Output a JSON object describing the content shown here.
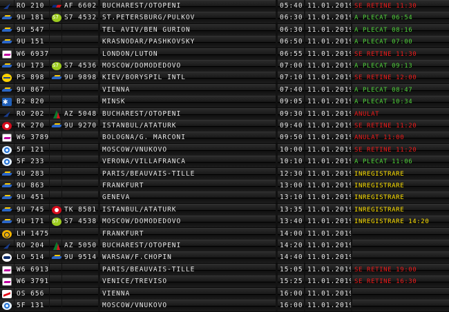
{
  "colors": {
    "text": "#e8e8e8",
    "status_red": "#f01a1a",
    "status_green": "#4fd13a",
    "status_yellow": "#ffe100",
    "board_bg": "#0a0a0a"
  },
  "flights": [
    {
      "logo1": "tarom-icon",
      "flight1": "RO 210",
      "logo2": "air-france-icon",
      "flight2": "AF 6602",
      "destination": "BUCHAREST/OTOPENI",
      "time": "05:40",
      "date": "11.01.2019",
      "status": "SE RETINE 11:30",
      "status_color": "red"
    },
    {
      "logo1": "wing-icon",
      "flight1": "9U 181",
      "logo2": "s7-icon",
      "flight2": "S7 4532",
      "destination": "ST.PETERSBURG/PULKOV",
      "time": "06:30",
      "date": "11.01.2019",
      "status": "A PLECAT 06:54",
      "status_color": "green"
    },
    {
      "logo1": "wing-icon",
      "flight1": "9U 547",
      "logo2": "",
      "flight2": "",
      "destination": "TEL AVIV/BEN GURION",
      "time": "06:30",
      "date": "11.01.2019",
      "status": "A PLECAT 08:16",
      "status_color": "green"
    },
    {
      "logo1": "wing-icon",
      "flight1": "9U 151",
      "logo2": "",
      "flight2": "",
      "destination": "KRASNODAR/PASHKOVSKY",
      "time": "06:50",
      "date": "11.01.2019",
      "status": "A PLECAT 07:00",
      "status_color": "green"
    },
    {
      "logo1": "wizz-icon",
      "flight1": "W6 6937",
      "logo2": "",
      "flight2": "",
      "destination": "LONDON/LUTON",
      "time": "06:55",
      "date": "11.01.2019",
      "status": "SE RETINE 11:30",
      "status_color": "red"
    },
    {
      "logo1": "wing-icon",
      "flight1": "9U 173",
      "logo2": "s7-icon",
      "flight2": "S7 4536",
      "destination": "MOSCOW/DOMODEDOVO",
      "time": "07:00",
      "date": "11.01.2019",
      "status": "A PLECAT 09:13",
      "status_color": "green"
    },
    {
      "logo1": "ps-icon",
      "flight1": "PS 898",
      "logo2": "wing-icon",
      "flight2": "9U 9898",
      "destination": "KIEV/BORYSPIL INTL",
      "time": "07:10",
      "date": "11.01.2019",
      "status": "SE RETINE 12:00",
      "status_color": "red"
    },
    {
      "logo1": "wing-icon",
      "flight1": "9U 867",
      "logo2": "",
      "flight2": "",
      "destination": "VIENNA",
      "time": "07:40",
      "date": "11.01.2019",
      "status": "A PLECAT 08:47",
      "status_color": "green"
    },
    {
      "logo1": "snowflake-icon",
      "flight1": "B2 820",
      "logo2": "",
      "flight2": "",
      "destination": "MINSK",
      "time": "09:05",
      "date": "11.01.2019",
      "status": "A PLECAT 10:34",
      "status_color": "green"
    },
    {
      "logo1": "tarom-icon",
      "flight1": "RO 202",
      "logo2": "alitalia-icon",
      "flight2": "AZ 5048",
      "destination": "BUCHAREST/OTOPENI",
      "time": "09:30",
      "date": "11.01.2019",
      "status": "ANULAT",
      "status_color": "red"
    },
    {
      "logo1": "turkish-icon",
      "flight1": "TK 270",
      "logo2": "wing-icon",
      "flight2": "9U 9270",
      "destination": "ISTANBUL/ATATURK",
      "time": "09:40",
      "date": "11.01.2019",
      "status": "SE RETINE 11:20",
      "status_color": "red"
    },
    {
      "logo1": "wizz-icon",
      "flight1": "W6 3789",
      "logo2": "",
      "flight2": "",
      "destination": "BOLOGNA/G. MARCONI",
      "time": "09:50",
      "date": "11.01.2019",
      "status": "ANULAT 11:00",
      "status_color": "red"
    },
    {
      "logo1": "flyone-icon",
      "flight1": "5F 121",
      "logo2": "",
      "flight2": "",
      "destination": "MOSCOW/VNUKOVO",
      "time": "10:00",
      "date": "11.01.2019",
      "status": "SE RETINE 11:20",
      "status_color": "red"
    },
    {
      "logo1": "flyone-icon",
      "flight1": "5F 233",
      "logo2": "",
      "flight2": "",
      "destination": "VERONA/VILLAFRANCA",
      "time": "10:10",
      "date": "11.01.2019",
      "status": "A PLECAT 11:06",
      "status_color": "green"
    },
    {
      "logo1": "wing-icon",
      "flight1": "9U 283",
      "logo2": "",
      "flight2": "",
      "destination": "PARIS/BEAUVAIS-TILLE",
      "time": "12:30",
      "date": "11.01.2019",
      "status": "INREGISTRARE",
      "status_color": "yellow"
    },
    {
      "logo1": "wing-icon",
      "flight1": "9U 863",
      "logo2": "",
      "flight2": "",
      "destination": "FRANKFURT",
      "time": "13:00",
      "date": "11.01.2019",
      "status": "INREGISTRARE",
      "status_color": "yellow"
    },
    {
      "logo1": "wing-icon",
      "flight1": "9U 451",
      "logo2": "",
      "flight2": "",
      "destination": "GENEVA",
      "time": "13:10",
      "date": "11.01.2019",
      "status": "INREGISTRARE",
      "status_color": "yellow"
    },
    {
      "logo1": "wing-icon",
      "flight1": "9U 745",
      "logo2": "turkish-icon",
      "flight2": "TK 8581",
      "destination": "ISTANBUL/ATATURK",
      "time": "13:35",
      "date": "11.01.2019",
      "status": "INREGISTRARE",
      "status_color": "yellow"
    },
    {
      "logo1": "wing-icon",
      "flight1": "9U 171",
      "logo2": "s7-icon",
      "flight2": "S7 4538",
      "destination": "MOSCOW/DOMODEDOVO",
      "time": "13:40",
      "date": "11.01.2019",
      "status": "INREGISTRARE 14:20",
      "status_color": "yellow"
    },
    {
      "logo1": "lufthansa-icon",
      "flight1": "LH 1475",
      "logo2": "",
      "flight2": "",
      "destination": "FRANKFURT",
      "time": "14:00",
      "date": "11.01.2019",
      "status": "",
      "status_color": "none"
    },
    {
      "logo1": "tarom-icon",
      "flight1": "RO 204",
      "logo2": "alitalia-icon",
      "flight2": "AZ 5050",
      "destination": "BUCHAREST/OTOPENI",
      "time": "14:20",
      "date": "11.01.2019",
      "status": "",
      "status_color": "none"
    },
    {
      "logo1": "lot-icon",
      "flight1": "LO 514",
      "logo2": "wing-icon",
      "flight2": "9U 9514",
      "destination": "WARSAW/F.CHOPIN",
      "time": "14:40",
      "date": "11.01.2019",
      "status": "",
      "status_color": "none"
    },
    {
      "logo1": "wizz-icon",
      "flight1": "W6 6913",
      "logo2": "",
      "flight2": "",
      "destination": "PARIS/BEAUVAIS-TILLE",
      "time": "15:05",
      "date": "11.01.2019",
      "status": "SE RETINE 19:00",
      "status_color": "red"
    },
    {
      "logo1": "wizz-icon",
      "flight1": "W6 3791",
      "logo2": "",
      "flight2": "",
      "destination": "VENICE/TREVISO",
      "time": "15:25",
      "date": "11.01.2019",
      "status": "SE RETINE 16:30",
      "status_color": "red"
    },
    {
      "logo1": "austrian-icon",
      "flight1": "OS 656",
      "logo2": "",
      "flight2": "",
      "destination": "VIENNA",
      "time": "16:00",
      "date": "11.01.2019",
      "status": "",
      "status_color": "none"
    },
    {
      "logo1": "flyone-icon",
      "flight1": "5F 131",
      "logo2": "",
      "flight2": "",
      "destination": "MOSCOW/VNUKOVO",
      "time": "16:00",
      "date": "11.01.2019",
      "status": "",
      "status_color": "none"
    }
  ]
}
